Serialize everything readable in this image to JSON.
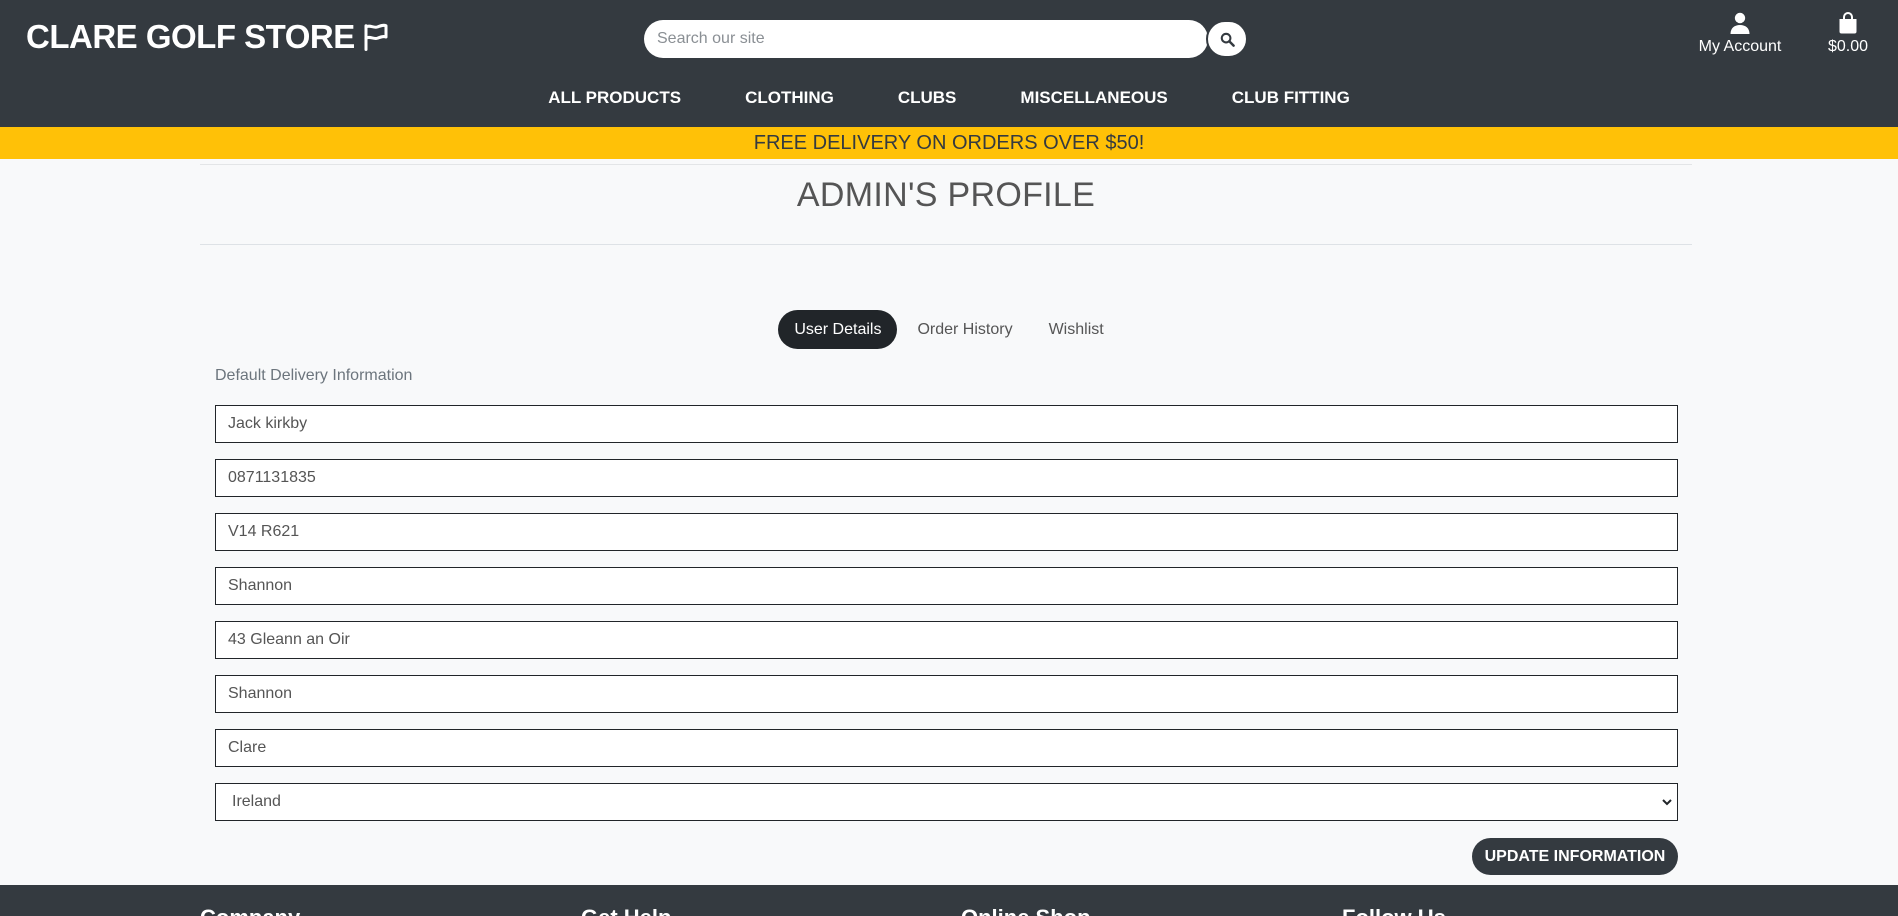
{
  "header": {
    "logo_text": "CLARE GOLF STORE",
    "search_placeholder": "Search our site",
    "account_label": "My Account",
    "cart_total": "$0.00"
  },
  "nav": {
    "items": [
      {
        "label": "ALL PRODUCTS"
      },
      {
        "label": "CLOTHING"
      },
      {
        "label": "CLUBS"
      },
      {
        "label": "MISCELLANEOUS"
      },
      {
        "label": "CLUB FITTING"
      }
    ]
  },
  "banner": {
    "text": "FREE DELIVERY ON ORDERS OVER $50!"
  },
  "page": {
    "title": "ADMIN'S PROFILE"
  },
  "tabs": [
    {
      "label": "User Details",
      "active": true
    },
    {
      "label": "Order History",
      "active": false
    },
    {
      "label": "Wishlist",
      "active": false
    }
  ],
  "form": {
    "section_label": "Default Delivery Information",
    "fields": [
      {
        "value": "Jack kirkby"
      },
      {
        "value": "0871131835"
      },
      {
        "value": "V14 R621"
      },
      {
        "value": "Shannon"
      },
      {
        "value": "43 Gleann an Oir"
      },
      {
        "value": "Shannon"
      },
      {
        "value": "Clare"
      }
    ],
    "country": "Ireland",
    "submit_label": "UPDATE INFORMATION"
  },
  "footer": {
    "headings": [
      "Company",
      "Get Help",
      "Online Shop",
      "Follow Us"
    ]
  },
  "colors": {
    "header_bg": "#343a40",
    "banner_bg": "#ffc107",
    "active_tab": "#212529"
  },
  "icons": {
    "logo": "flag-icon",
    "search": "search-icon",
    "account": "user-icon",
    "cart": "shopping-bag-icon",
    "select": "chevron-down-icon"
  }
}
